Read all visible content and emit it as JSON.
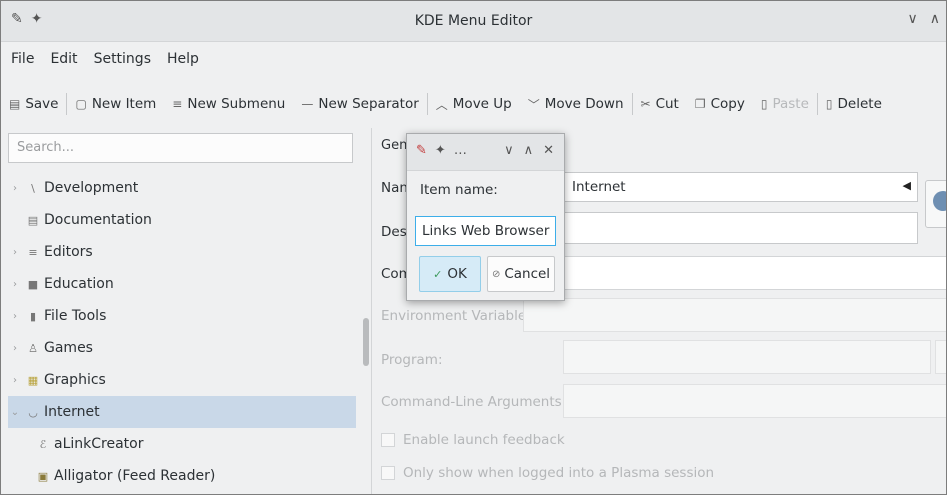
{
  "window": {
    "title": "KDE Menu Editor",
    "minimize_glyph": "∨",
    "maximize_glyph": "∧"
  },
  "menubar": [
    "File",
    "Edit",
    "Settings",
    "Help"
  ],
  "toolbar": {
    "save": "Save",
    "new_item": "New Item",
    "new_submenu": "New Submenu",
    "new_separator": "New Separator",
    "move_up": "Move Up",
    "move_down": "Move Down",
    "cut": "Cut",
    "copy": "Copy",
    "paste": "Paste",
    "delete": "Delete"
  },
  "sidebar": {
    "search_placeholder": "Search...",
    "tree": [
      {
        "label": "Development",
        "icon": "development-icon"
      },
      {
        "label": "Documentation",
        "icon": "documentation-icon"
      },
      {
        "label": "Editors",
        "icon": "editors-icon"
      },
      {
        "label": "Education",
        "icon": "education-icon"
      },
      {
        "label": "File Tools",
        "icon": "file-tools-icon"
      },
      {
        "label": "Games",
        "icon": "games-icon"
      },
      {
        "label": "Graphics",
        "icon": "graphics-icon"
      },
      {
        "label": "Internet",
        "icon": "internet-icon",
        "expanded": true,
        "selected": true
      },
      {
        "label": "aLinkCreator",
        "icon": "alinkcreator-icon",
        "child": true
      },
      {
        "label": "Alligator (Feed Reader)",
        "icon": "alligator-icon",
        "child": true
      }
    ]
  },
  "main": {
    "tab_general": "Gen",
    "name_label": "Nan",
    "name_value": "Internet",
    "description_label": "Des",
    "comment_label": "Com",
    "env_label": "Environment Variables:",
    "program_label": "Program:",
    "cmdline_label": "Command-Line Arguments:",
    "launch_feedback": "Enable launch feedback",
    "plasma_only": "Only show when logged into a Plasma session"
  },
  "dialog": {
    "label": "Item name:",
    "value": "Links Web Browser",
    "ok": "OK",
    "cancel": "Cancel"
  }
}
